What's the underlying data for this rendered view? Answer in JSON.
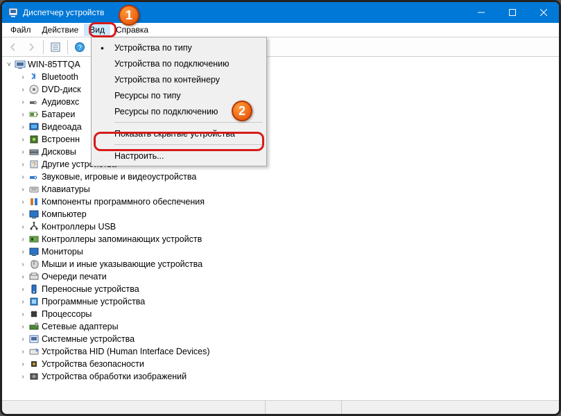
{
  "window": {
    "title": "Диспетчер устройств"
  },
  "menu": {
    "file": "Файл",
    "action": "Действие",
    "view": "Вид",
    "help": "Справка"
  },
  "dropdown": {
    "items": [
      {
        "label": "Устройства по типу",
        "bullet": true
      },
      {
        "label": "Устройства по подключению",
        "bullet": false
      },
      {
        "label": "Устройства по контейнеру",
        "bullet": false
      },
      {
        "label": "Ресурсы по типу",
        "bullet": false
      },
      {
        "label": "Ресурсы по подключению",
        "bullet": false
      }
    ],
    "show_hidden": "Показать скрытые устройства",
    "customize": "Настроить..."
  },
  "tree": {
    "root": "WIN-85TTQA",
    "nodes": [
      "Bluetooth",
      "DVD-диск",
      "Аудиовхс",
      "Батареи",
      "Видеоада",
      "Встроенн",
      "Дисковы",
      "Другие устройства",
      "Звуковые, игровые и видеоустройства",
      "Клавиатуры",
      "Компоненты программного обеспечения",
      "Компьютер",
      "Контроллеры USB",
      "Контроллеры запоминающих устройств",
      "Мониторы",
      "Мыши и иные указывающие устройства",
      "Очереди печати",
      "Переносные устройства",
      "Программные устройства",
      "Процессоры",
      "Сетевые адаптеры",
      "Системные устройства",
      "Устройства HID (Human Interface Devices)",
      "Устройства безопасности",
      "Устройства обработки изображений"
    ]
  },
  "status": {
    "c1": "",
    "c2": "",
    "c3": ""
  },
  "callouts": {
    "one": "1",
    "two": "2"
  }
}
